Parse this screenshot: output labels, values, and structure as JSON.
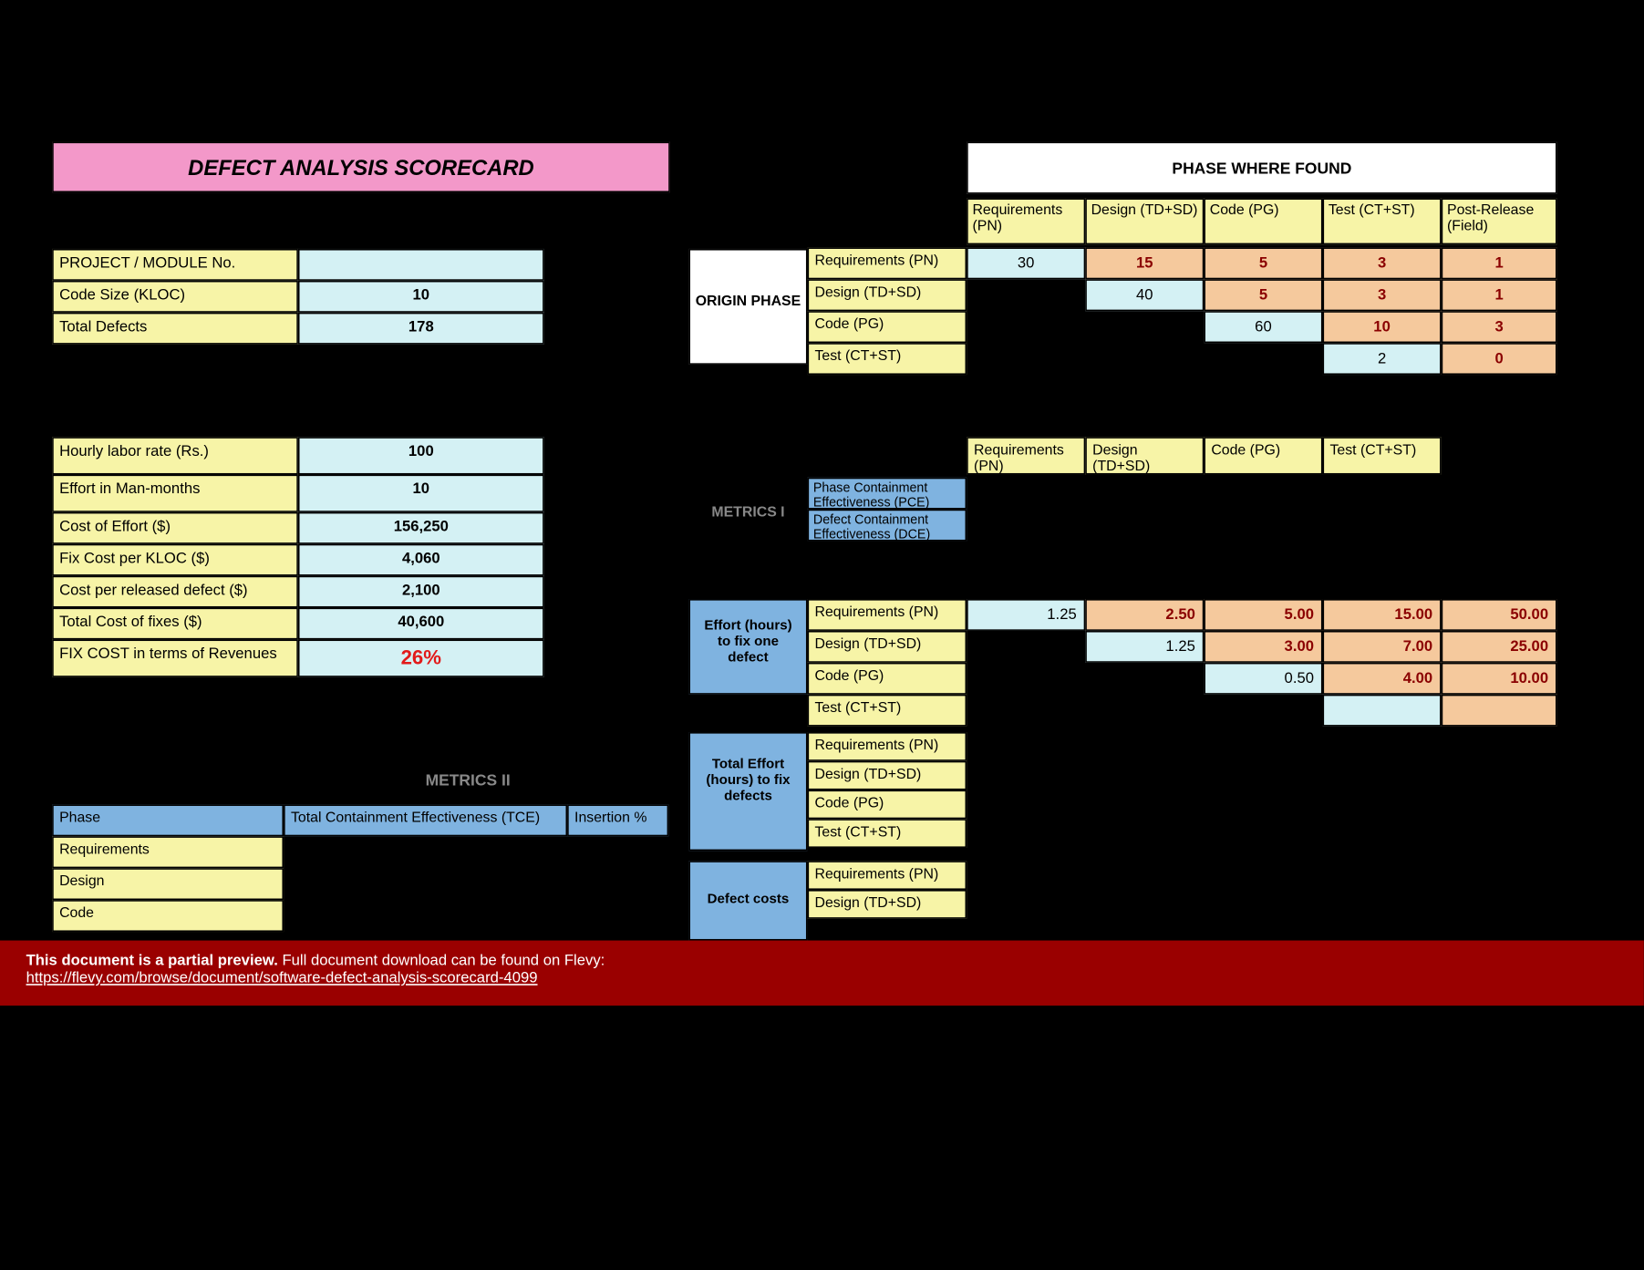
{
  "title": "DEFECT ANALYSIS SCORECARD",
  "kv1": {
    "projectLabel": "PROJECT / MODULE No.",
    "projectValue": "",
    "klocLabel": "Code Size (KLOC)",
    "klocValue": "10",
    "defectsLabel": "Total Defects",
    "defectsValue": "178"
  },
  "kv2": {
    "rateLabel": "Hourly labor rate (Rs.)",
    "rateValue": "100",
    "effortLabel": "Effort in Man-months",
    "effortValue": "10",
    "costEffortLabel": "Cost of Effort ($)",
    "costEffortValue": "156,250",
    "fixPerKlocLabel": "Fix Cost per KLOC ($)",
    "fixPerKlocValue": "4,060",
    "costReleasedLabel": "Cost per released defect ($)",
    "costReleasedValue": "2,100",
    "totalCostLabel": "Total Cost of fixes ($)",
    "totalCostValue": "40,600",
    "fixRevenueLabel": "FIX COST in terms of Revenues",
    "fixRevenueValue": "26%"
  },
  "phaseFoundHeader": "PHASE WHERE FOUND",
  "cols": [
    "Requirements (PN)",
    "Design (TD+SD)",
    "Code (PG)",
    "Test (CT+ST)",
    "Post-Release (Field)"
  ],
  "originHeader": "ORIGIN PHASE",
  "rows": [
    "Requirements (PN)",
    "Design (TD+SD)",
    "Code (PG)",
    "Test (CT+ST)"
  ],
  "origin": [
    [
      "30",
      "15",
      "5",
      "3",
      "1"
    ],
    [
      "",
      "40",
      "5",
      "3",
      "1"
    ],
    [
      "",
      "",
      "60",
      "10",
      "3"
    ],
    [
      "",
      "",
      "",
      "2",
      "0"
    ]
  ],
  "metricsIHeader": "METRICS I",
  "m1rows": [
    "Phase Containment Effectiveness (PCE)",
    "Defect Containment Effectiveness (DCE)"
  ],
  "m1cols": [
    "Requirements (PN)",
    "Design (TD+SD)",
    "Code (PG)",
    "Test (CT+ST)"
  ],
  "effortHeader": "Effort (hours) to fix one defect",
  "effort": [
    [
      "1.25",
      "2.50",
      "5.00",
      "15.00",
      "50.00"
    ],
    [
      "",
      "1.25",
      "3.00",
      "7.00",
      "25.00"
    ],
    [
      "",
      "",
      "0.50",
      "4.00",
      "10.00"
    ],
    [
      "",
      "",
      "",
      "",
      ""
    ]
  ],
  "totalEffortHeader": "Total Effort (hours) to fix defects",
  "defectCostsHeader": "Defect costs",
  "metricsIIHeader": "METRICS II",
  "m2": {
    "phaseH": "Phase",
    "tceH": "Total Containment Effectiveness (TCE)",
    "insH": "Insertion %",
    "rows": [
      "Requirements",
      "Design",
      "Code"
    ]
  },
  "notice": {
    "bold": "This document is a partial preview.",
    "rest": " Full document download can be found on Flevy:",
    "url": "https://flevy.com/browse/document/software-defect-analysis-scorecard-4099"
  }
}
